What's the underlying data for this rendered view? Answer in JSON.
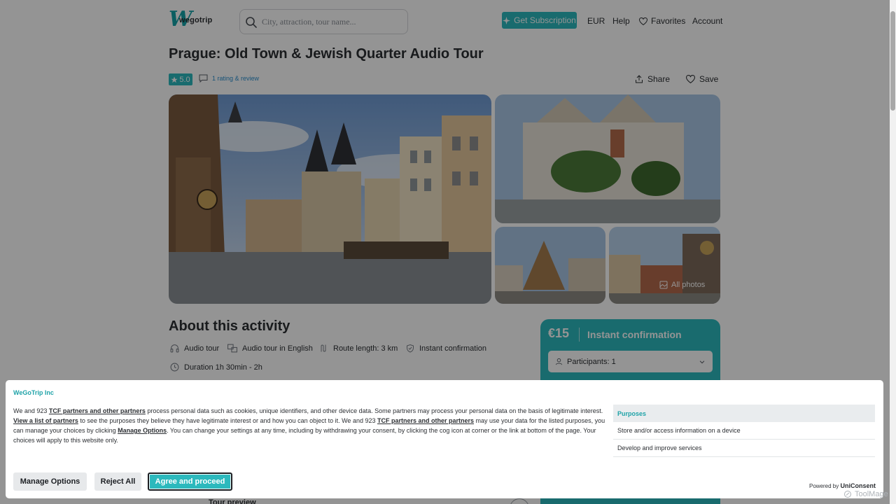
{
  "header": {
    "logo_letter": "W",
    "logo_text": "wegotrip",
    "search_placeholder": "City, attraction, tour name...",
    "subscription_label": "Get Subscription",
    "currency": "EUR",
    "help": "Help",
    "favorites": "Favorites",
    "account": "Account"
  },
  "tour": {
    "title": "Prague: Old Town & Jewish Quarter Audio Tour",
    "rating": "5.0",
    "reviews": "1 rating & review",
    "share": "Share",
    "save": "Save",
    "all_photos": "All photos"
  },
  "about": {
    "title": "About this activity",
    "features": [
      {
        "label": "Audio tour",
        "icon": "headphones-icon"
      },
      {
        "label": "Audio tour in English",
        "icon": "language-icon"
      },
      {
        "label": "Route length: 3 km",
        "icon": "route-icon"
      },
      {
        "label": "Instant confirmation",
        "icon": "shield-check-icon"
      },
      {
        "label": "Duration 1h 30min - 2h",
        "icon": "clock-icon"
      }
    ]
  },
  "booking": {
    "price": "€15",
    "instant": "Instant confirmation",
    "participants": "Participants: 1"
  },
  "preview": {
    "label": "Tour preview"
  },
  "consent": {
    "company": "WeGoTrip Inc",
    "text_1": "We and 923 ",
    "link_partners": "TCF partners and other partners",
    "text_2": " process personal data such as cookies, unique identifiers, and other device data. Some partners may process your personal data on the basis of legitimate interest. ",
    "link_list": "View a list of partners",
    "text_3": " to see the purposes they believe they have legitimate interest or and how you can object to it. We and 923 ",
    "text_4": " may use your data for the listed purposes, you can manage your choices by clicking ",
    "link_manage": "Manage Options",
    "text_5": ". You can change your settings at any time, including by withdrawing your consent, by clicking the cog icon at corner or the link at bottom of the page. Your choices will apply to this website only.",
    "purposes_title": "Purposes",
    "purposes": [
      "Store and/or access information on a device",
      "Develop and improve services"
    ],
    "manage_btn": "Manage Options",
    "reject_btn": "Reject All",
    "agree_btn": "Agree and proceed",
    "powered_prefix": "Powered by ",
    "powered_brand": "UniConsent"
  },
  "watermark": "ToolMage",
  "colors": {
    "accent": "#2cb9bd",
    "overlay": "#000000"
  }
}
